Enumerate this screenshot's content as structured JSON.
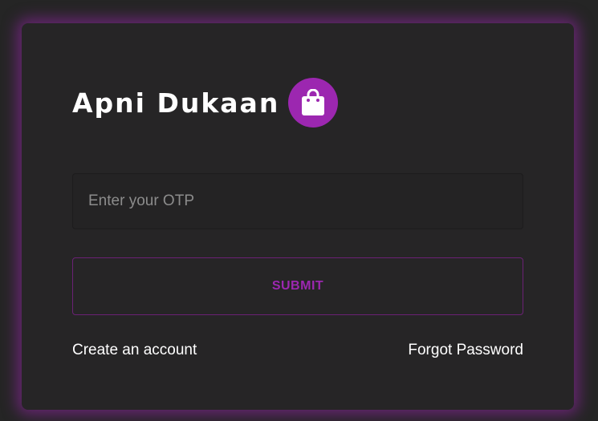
{
  "brand": {
    "title": "Apni Dukaan",
    "logo_icon": "shopping-bag-icon",
    "accent_color": "#9c27b0"
  },
  "otp": {
    "value": "",
    "placeholder": "Enter your OTP"
  },
  "submit": {
    "label": "SUBMIT"
  },
  "links": {
    "create_account": "Create an account",
    "forgot_password": "Forgot Password"
  }
}
